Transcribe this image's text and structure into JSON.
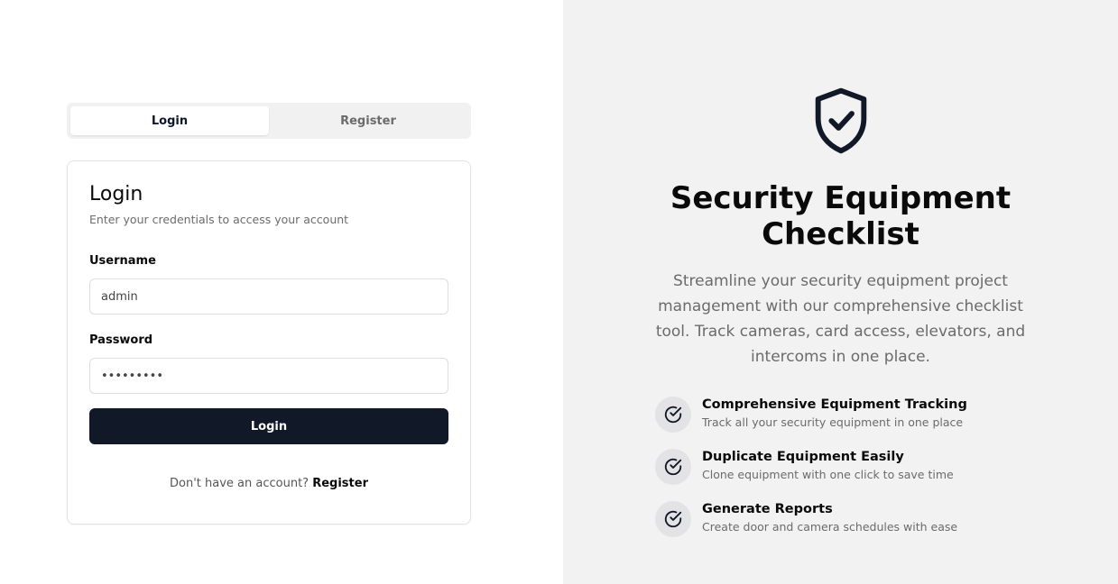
{
  "tabs": [
    {
      "label": "Login",
      "active": true
    },
    {
      "label": "Register",
      "active": false
    }
  ],
  "login_card": {
    "title": "Login",
    "subtitle": "Enter your credentials to access your account",
    "username_label": "Username",
    "username_value": "admin",
    "password_label": "Password",
    "password_value": "password1",
    "submit_label": "Login",
    "footer_text": "Don't have an account?",
    "footer_link": "Register"
  },
  "hero": {
    "icon": "shield-check-icon",
    "title": "Security Equipment Checklist",
    "description": "Streamline your security equipment project management with our comprehensive checklist tool. Track cameras, card access, elevators, and intercoms in one place."
  },
  "features": [
    {
      "icon": "check-circle-icon",
      "title": "Comprehensive Equipment Tracking",
      "description": "Track all your security equipment in one place"
    },
    {
      "icon": "check-circle-icon",
      "title": "Duplicate Equipment Easily",
      "description": "Clone equipment with one click to save time"
    },
    {
      "icon": "check-circle-icon",
      "title": "Generate Reports",
      "description": "Create door and camera schedules with ease"
    }
  ],
  "colors": {
    "primary": "#111827",
    "panel_bg": "#f2f2f2",
    "muted_text": "#6b6b6b",
    "icon_circle": "#e3e3e5"
  }
}
